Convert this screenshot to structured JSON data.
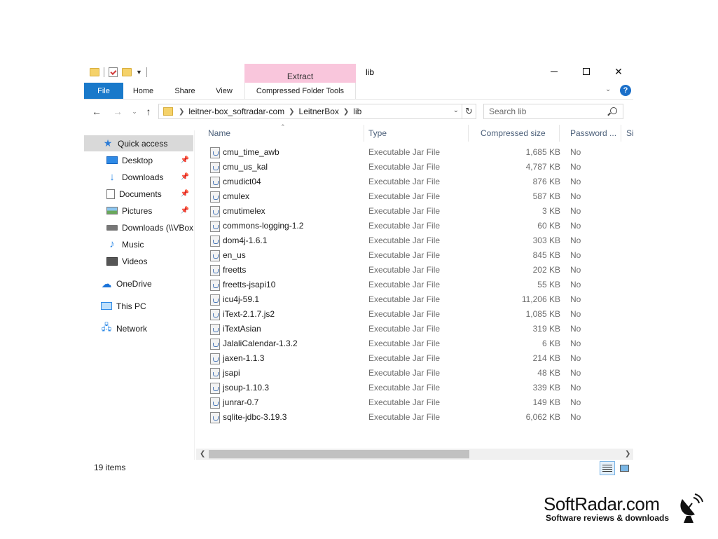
{
  "window": {
    "title": "lib",
    "context_tab": "Extract"
  },
  "ribbon": {
    "tabs": {
      "file": "File",
      "home": "Home",
      "share": "Share",
      "view": "View",
      "compressed": "Compressed Folder Tools"
    },
    "help": "?"
  },
  "address": {
    "crumbs": [
      "leitner-box_softradar-com",
      "LeitnerBox",
      "lib"
    ]
  },
  "search": {
    "placeholder": "Search lib"
  },
  "nav": {
    "quick_access": "Quick access",
    "desktop": "Desktop",
    "downloads": "Downloads",
    "documents": "Documents",
    "pictures": "Pictures",
    "downloads_vbox": "Downloads (\\\\VBox",
    "music": "Music",
    "videos": "Videos",
    "onedrive": "OneDrive",
    "this_pc": "This PC",
    "network": "Network"
  },
  "columns": {
    "name": "Name",
    "type": "Type",
    "size": "Compressed size",
    "password": "Password ...",
    "extra": "Si"
  },
  "files": [
    {
      "name": "cmu_time_awb",
      "type": "Executable Jar File",
      "size": "1,685 KB",
      "password": "No"
    },
    {
      "name": "cmu_us_kal",
      "type": "Executable Jar File",
      "size": "4,787 KB",
      "password": "No"
    },
    {
      "name": "cmudict04",
      "type": "Executable Jar File",
      "size": "876 KB",
      "password": "No"
    },
    {
      "name": "cmulex",
      "type": "Executable Jar File",
      "size": "587 KB",
      "password": "No"
    },
    {
      "name": "cmutimelex",
      "type": "Executable Jar File",
      "size": "3 KB",
      "password": "No"
    },
    {
      "name": "commons-logging-1.2",
      "type": "Executable Jar File",
      "size": "60 KB",
      "password": "No"
    },
    {
      "name": "dom4j-1.6.1",
      "type": "Executable Jar File",
      "size": "303 KB",
      "password": "No"
    },
    {
      "name": "en_us",
      "type": "Executable Jar File",
      "size": "845 KB",
      "password": "No"
    },
    {
      "name": "freetts",
      "type": "Executable Jar File",
      "size": "202 KB",
      "password": "No"
    },
    {
      "name": "freetts-jsapi10",
      "type": "Executable Jar File",
      "size": "55 KB",
      "password": "No"
    },
    {
      "name": "icu4j-59.1",
      "type": "Executable Jar File",
      "size": "11,206 KB",
      "password": "No"
    },
    {
      "name": "iText-2.1.7.js2",
      "type": "Executable Jar File",
      "size": "1,085 KB",
      "password": "No"
    },
    {
      "name": "iTextAsian",
      "type": "Executable Jar File",
      "size": "319 KB",
      "password": "No"
    },
    {
      "name": "JalaliCalendar-1.3.2",
      "type": "Executable Jar File",
      "size": "6 KB",
      "password": "No"
    },
    {
      "name": "jaxen-1.1.3",
      "type": "Executable Jar File",
      "size": "214 KB",
      "password": "No"
    },
    {
      "name": "jsapi",
      "type": "Executable Jar File",
      "size": "48 KB",
      "password": "No"
    },
    {
      "name": "jsoup-1.10.3",
      "type": "Executable Jar File",
      "size": "339 KB",
      "password": "No"
    },
    {
      "name": "junrar-0.7",
      "type": "Executable Jar File",
      "size": "149 KB",
      "password": "No"
    },
    {
      "name": "sqlite-jdbc-3.19.3",
      "type": "Executable Jar File",
      "size": "6,062 KB",
      "password": "No"
    }
  ],
  "status": {
    "count": "19 items"
  },
  "watermark": {
    "brand": "SoftRadar.com",
    "tagline": "Software reviews & downloads"
  },
  "colors": {
    "file_tab": "#1979ca",
    "context_tab": "#f9c6dc",
    "selected_nav": "#d9d9d9",
    "header_text": "#4c607a"
  }
}
